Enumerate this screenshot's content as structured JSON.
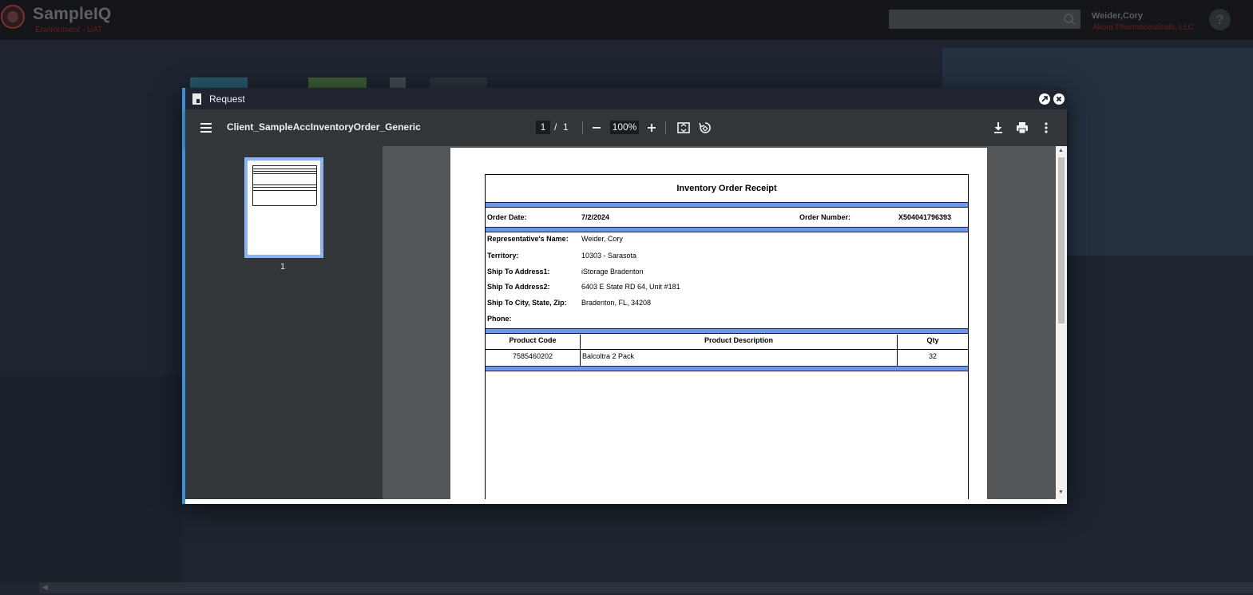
{
  "app": {
    "brand": "SampleIQ",
    "environment": "Environment - UAT",
    "search_placeholder": "",
    "user_name": "Weider,Cory",
    "user_org": "Akora Pharmaceuticals, LLC",
    "help_label": "?"
  },
  "modal": {
    "title": "Request"
  },
  "pdf_toolbar": {
    "document_name": "Client_SampleAccInventoryOrder_Generic",
    "current_page": "1",
    "page_separator": "/",
    "total_pages": "1",
    "zoom": "100%"
  },
  "thumbnails": [
    {
      "label": "1"
    }
  ],
  "receipt": {
    "title": "Inventory Order Receipt",
    "order_date_label": "Order Date:",
    "order_date": "7/2/2024",
    "order_number_label": "Order Number:",
    "order_number": "X504041796393",
    "fields": [
      {
        "label": "Representative's Name:",
        "value": "Weider, Cory"
      },
      {
        "label": "Territory:",
        "value": "10303 - Sarasota"
      },
      {
        "label": "Ship To Address1:",
        "value": "iStorage Bradenton"
      },
      {
        "label": "Ship To Address2:",
        "value": "6403 E State RD 64, Unit #181"
      },
      {
        "label": "Ship To City, State, Zip:",
        "value": "Bradenton, FL, 34208"
      },
      {
        "label": "Phone:",
        "value": ""
      }
    ],
    "table": {
      "headers": [
        "Product Code",
        "Product Description",
        "Qty"
      ],
      "rows": [
        [
          "7585460202",
          "Balcoltra 2 Pack",
          "32"
        ]
      ]
    }
  },
  "colors": {
    "accent": "#3b8fd6",
    "band": "#6a98e6",
    "brand_red": "#6a2020"
  }
}
